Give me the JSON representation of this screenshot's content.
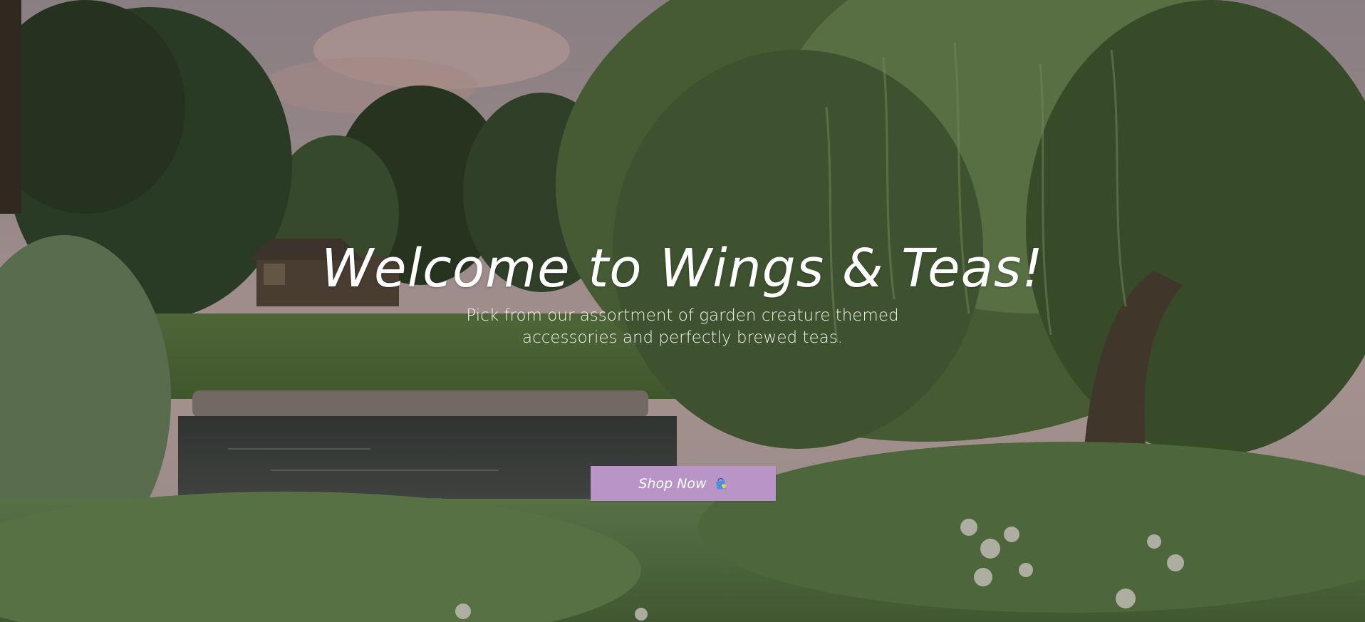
{
  "hero": {
    "title": "Welcome to Wings & Teas!",
    "subtitle": "Pick from our assortment of garden creature themed accessories and perfectly brewed teas.",
    "background_icon": "garden-pond-photo",
    "cta": {
      "label": "Shop Now",
      "icon": "shopping-bag-icon",
      "background_color": "#b895c6",
      "text_color": "#ffffff"
    }
  }
}
